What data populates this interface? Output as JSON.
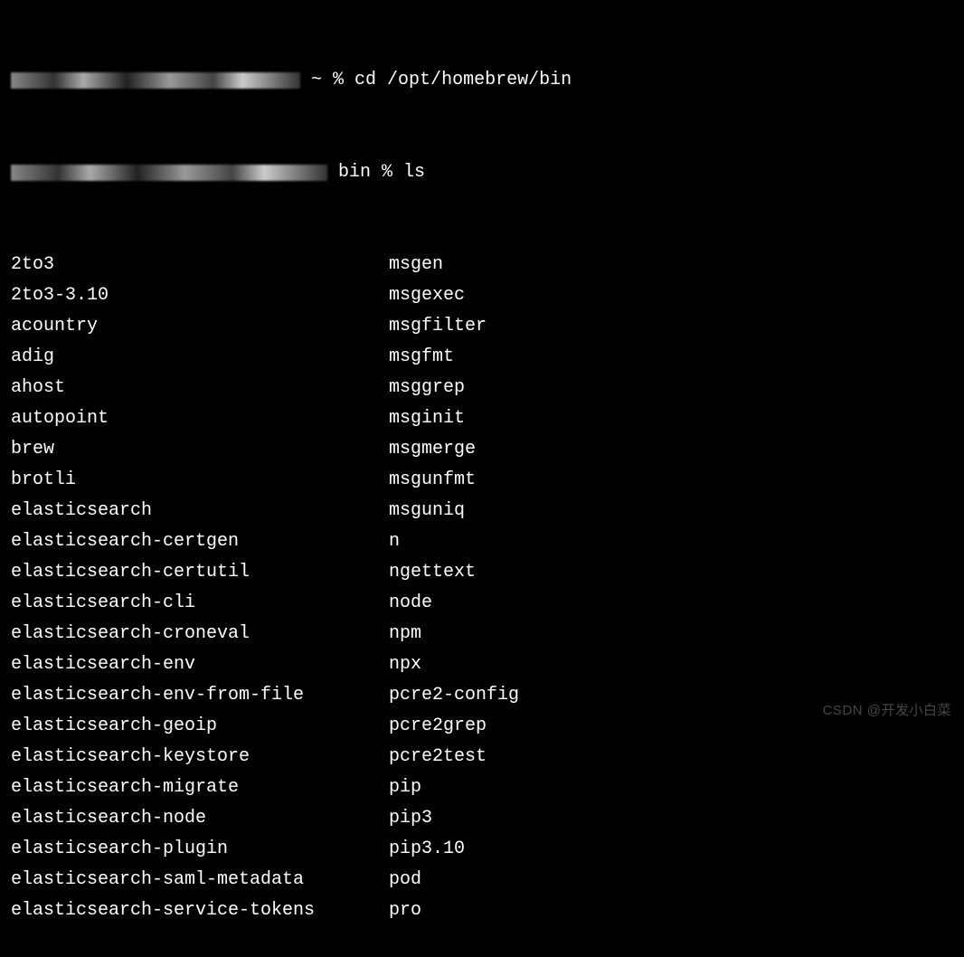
{
  "prompt1": {
    "path": " ~ ",
    "symbol": "%",
    "command": "cd /opt/homebrew/bin"
  },
  "prompt2": {
    "path": " bin ",
    "symbol": "%",
    "command": "ls"
  },
  "listing": {
    "col1": [
      "2to3",
      "2to3-3.10",
      "acountry",
      "adig",
      "ahost",
      "autopoint",
      "brew",
      "brotli",
      "elasticsearch",
      "elasticsearch-certgen",
      "elasticsearch-certutil",
      "elasticsearch-cli",
      "elasticsearch-croneval",
      "elasticsearch-env",
      "elasticsearch-env-from-file",
      "elasticsearch-geoip",
      "elasticsearch-keystore",
      "elasticsearch-migrate",
      "elasticsearch-node",
      "elasticsearch-plugin",
      "elasticsearch-saml-metadata",
      "elasticsearch-service-tokens"
    ],
    "col2": [
      "msgen",
      "msgexec",
      "msgfilter",
      "msgfmt",
      "msggrep",
      "msginit",
      "msgmerge",
      "msgunfmt",
      "msguniq",
      "n",
      "ngettext",
      "node",
      "npm",
      "npx",
      "pcre2-config",
      "pcre2grep",
      "pcre2test",
      "pip",
      "pip3",
      "pip3.10",
      "pod",
      "pro"
    ]
  },
  "watermark": "CSDN @开发小白菜"
}
